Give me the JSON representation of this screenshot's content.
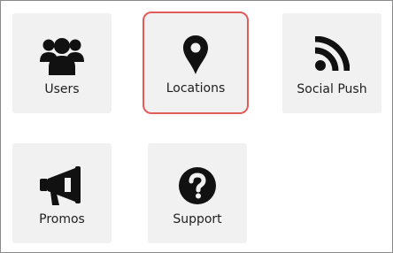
{
  "tiles": [
    {
      "label": "Users",
      "icon": "users-icon",
      "selected": false
    },
    {
      "label": "Locations",
      "icon": "map-pin-icon",
      "selected": true
    },
    {
      "label": "Social Push",
      "icon": "rss-icon",
      "selected": false
    },
    {
      "label": "Promos",
      "icon": "megaphone-icon",
      "selected": false
    },
    {
      "label": "Support",
      "icon": "question-circle-icon",
      "selected": false
    }
  ],
  "colors": {
    "tile_background": "#f1f1f1",
    "selected_border": "#e25c5c",
    "icon": "#111111",
    "text": "#1e1e1e"
  }
}
